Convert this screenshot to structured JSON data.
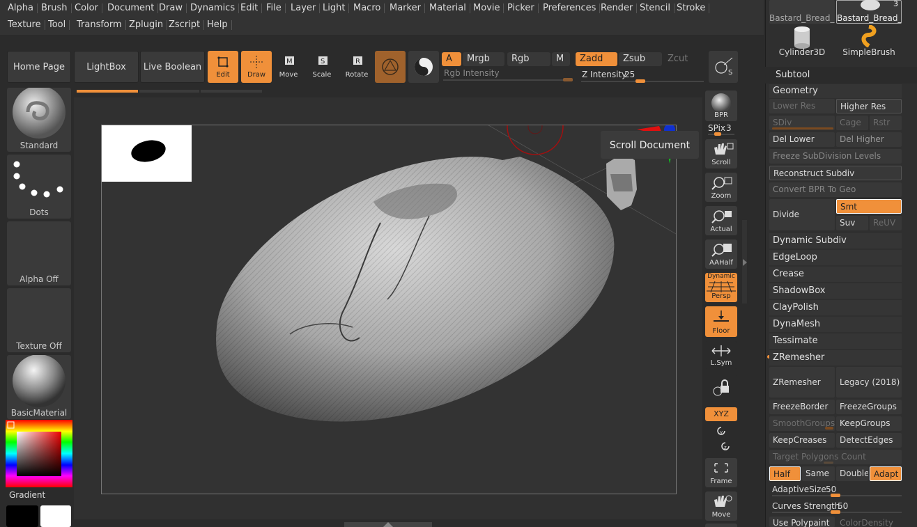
{
  "menu": {
    "row1": [
      "Alpha",
      "Brush",
      "Color",
      "Document",
      "Draw",
      "Dynamics",
      "Edit",
      "File",
      "Layer",
      "Light",
      "Macro",
      "Marker",
      "Material",
      "Movie",
      "Picker",
      "Preferences",
      "Render",
      "Stencil",
      "Stroke"
    ],
    "row2": [
      "Texture",
      "Tool",
      "Transform",
      "Zplugin",
      "Zscript",
      "Help"
    ]
  },
  "toolbar": {
    "home_page": "Home Page",
    "lightbox": "LightBox",
    "live_boolean": "Live Boolean",
    "edit": "Edit",
    "draw": "Draw",
    "move": "Move",
    "scale": "Scale",
    "rotate": "Rotate",
    "a": "A",
    "mrgb": "Mrgb",
    "rgb": "Rgb",
    "m": "M",
    "zadd": "Zadd",
    "zsub": "Zsub",
    "zcut": "Zcut",
    "rgb_intensity": "Rgb Intensity",
    "z_intensity_label": "Z Intensity",
    "z_intensity_value": "25"
  },
  "left_panel": {
    "brush": "Standard",
    "stroke": "Dots",
    "alpha": "Alpha Off",
    "texture": "Texture Off",
    "material": "BasicMaterial",
    "gradient": "Gradient"
  },
  "tooltip": "Scroll Document",
  "right_tools": {
    "bpr": "BPR",
    "spix_label": "SPix",
    "spix_value": "3",
    "scroll": "Scroll",
    "zoom": "Zoom",
    "actual": "Actual",
    "aahalf": "AAHalf",
    "dynamic": "Dynamic",
    "persp": "Persp",
    "floor": "Floor",
    "lsym": "L.Sym",
    "xyz": "XYZ",
    "frame": "Frame",
    "move": "Move"
  },
  "tool_panel": {
    "thumbs": [
      "Bastard_Bread_l",
      "Bastard_Bread_l",
      "Cylinder3D",
      "SimpleBrush"
    ],
    "thumb_badge": "3",
    "subtool": "Subtool",
    "geometry": "Geometry",
    "lower_res": "Lower Res",
    "higher_res": "Higher Res",
    "sdiv": "SDiv",
    "cage": "Cage",
    "rstr": "Rstr",
    "del_lower": "Del Lower",
    "del_higher": "Del Higher",
    "freeze_subdiv": "Freeze SubDivision Levels",
    "reconstruct_subdiv": "Reconstruct Subdiv",
    "convert_bpr": "Convert BPR To Geo",
    "divide": "Divide",
    "smt": "Smt",
    "suv": "Suv",
    "reuv": "ReUV",
    "dynamic_subdiv": "Dynamic Subdiv",
    "edgeloop": "EdgeLoop",
    "crease": "Crease",
    "shadowbox": "ShadowBox",
    "claypolish": "ClayPolish",
    "dynamesh": "DynaMesh",
    "tessimate": "Tessimate",
    "zremesher_header": "ZRemesher",
    "zremesher_btn": "ZRemesher",
    "legacy": "Legacy (2018)",
    "freezeborder": "FreezeBorder",
    "freezegroups": "FreezeGroups",
    "smoothgroups": "SmoothGroups",
    "keepgroups": "KeepGroups",
    "keepcreases": "KeepCreases",
    "detectedges": "DetectEdges",
    "target_poly": "Target Polygons Count",
    "half": "Half",
    "same": "Same",
    "double": "Double",
    "adapt": "Adapt",
    "adaptive_size_label": "AdaptiveSize",
    "adaptive_size_value": "50",
    "curves_strength_label": "Curves Strength",
    "curves_strength_value": "50",
    "use_polypaint": "Use Polypaint",
    "color_density": "ColorDensity"
  },
  "colors": {
    "accent": "#f0903a",
    "bg": "#2b2b2b"
  }
}
